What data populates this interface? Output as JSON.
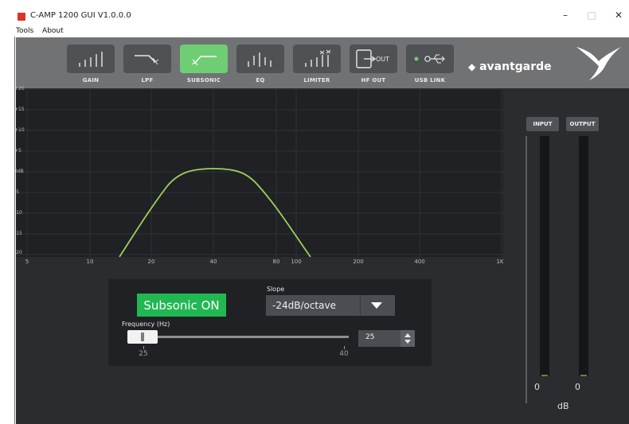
{
  "window": {
    "title": "C-AMP 1200  GUI V1.0.0.0",
    "minimize": "–",
    "maximize": "□",
    "close": "✕"
  },
  "menu": [
    "Tools",
    "About"
  ],
  "toolbar": [
    {
      "label": "GAIN",
      "icon": "gain-bars-icon",
      "active": false
    },
    {
      "label": "LPF",
      "icon": "lowpass-icon",
      "active": false
    },
    {
      "label": "SUBSONIC",
      "icon": "highpass-icon",
      "active": true
    },
    {
      "label": "EQ",
      "icon": "eq-icon",
      "active": false
    },
    {
      "label": "LIMITER",
      "icon": "limiter-icon",
      "active": false
    },
    {
      "label": "HF OUT",
      "icon": "hf-out-icon",
      "button_text": "OUT",
      "active": false
    },
    {
      "label": "USB LINK",
      "icon": "usb-icon",
      "active": false
    }
  ],
  "brand": {
    "name": "avantgarde",
    "logo_icon": "hummingbird-icon"
  },
  "graph": {
    "y_labels": [
      "+20",
      "+15",
      "+10",
      "+5",
      "0dB",
      "-5",
      "-10",
      "-15",
      "-20"
    ],
    "x_labels": [
      "5",
      "10",
      "20",
      "40",
      "80",
      "100",
      "200",
      "400",
      "1K"
    ],
    "curve_color": "#9fcf5d",
    "background": "#1f2124"
  },
  "subsonic": {
    "toggle_label": "Subsonic ON",
    "slope_label": "Slope",
    "slope_value": "-24dB/octave",
    "frequency_label": "Frequency (Hz)",
    "frequency_min": "25",
    "frequency_max": "40",
    "frequency_value": "25",
    "frequency_fraction": 0.0,
    "toggle_color": "#21b753"
  },
  "meters": {
    "input_label": "INPUT",
    "output_label": "OUTPUT",
    "input_value": "0",
    "output_value": "0",
    "unit": "dB"
  },
  "colors": {
    "active_tab": "#6fce73",
    "toolbar": "#717274",
    "app_bg": "#2a2c2f"
  }
}
